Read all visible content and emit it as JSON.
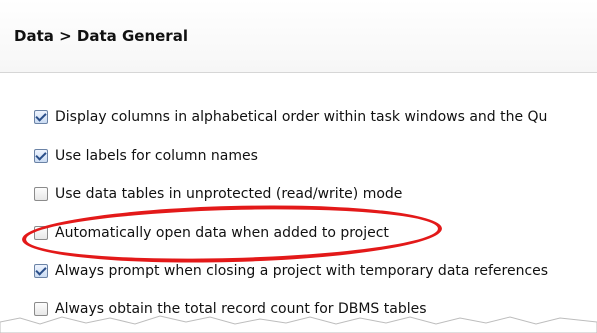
{
  "title": "Data > Data General",
  "options": [
    {
      "label": "Display columns in alphabetical order within task windows and the Qu",
      "checked": true
    },
    {
      "label": "Use labels for column names",
      "checked": true
    },
    {
      "label": "Use data tables in unprotected (read/write) mode",
      "checked": false
    },
    {
      "label": "Automatically open data when added to project",
      "checked": false
    },
    {
      "label": "Always prompt when closing a project with temporary data references",
      "checked": true
    },
    {
      "label": "Always obtain the total record count for DBMS tables",
      "checked": false
    }
  ],
  "colors": {
    "highlight": "#e31919",
    "checkbox_check": "#2b4f8a"
  }
}
